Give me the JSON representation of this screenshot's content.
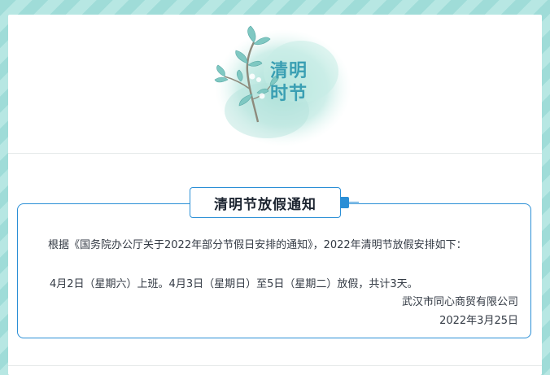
{
  "hero": {
    "title_line1": "清明",
    "title_line2": "时节"
  },
  "notice": {
    "title": "清明节放假通知",
    "paragraph1": "根据《国务院办公厅关于2022年部分节假日安排的通知》，2022年清明节放假安排如下：",
    "paragraph2": "4月2日（星期六）上班。4月3日（星期日）至5日（星期二）放假，共计3天。",
    "company": "武汉市同心商贸有限公司",
    "date": "2022年3月25日"
  },
  "colors": {
    "accent": "#2b8fd6",
    "background_stripe_1": "#9fdcd8",
    "background_stripe_2": "#b7e7e3",
    "hero_title": "#3a9fb3"
  }
}
